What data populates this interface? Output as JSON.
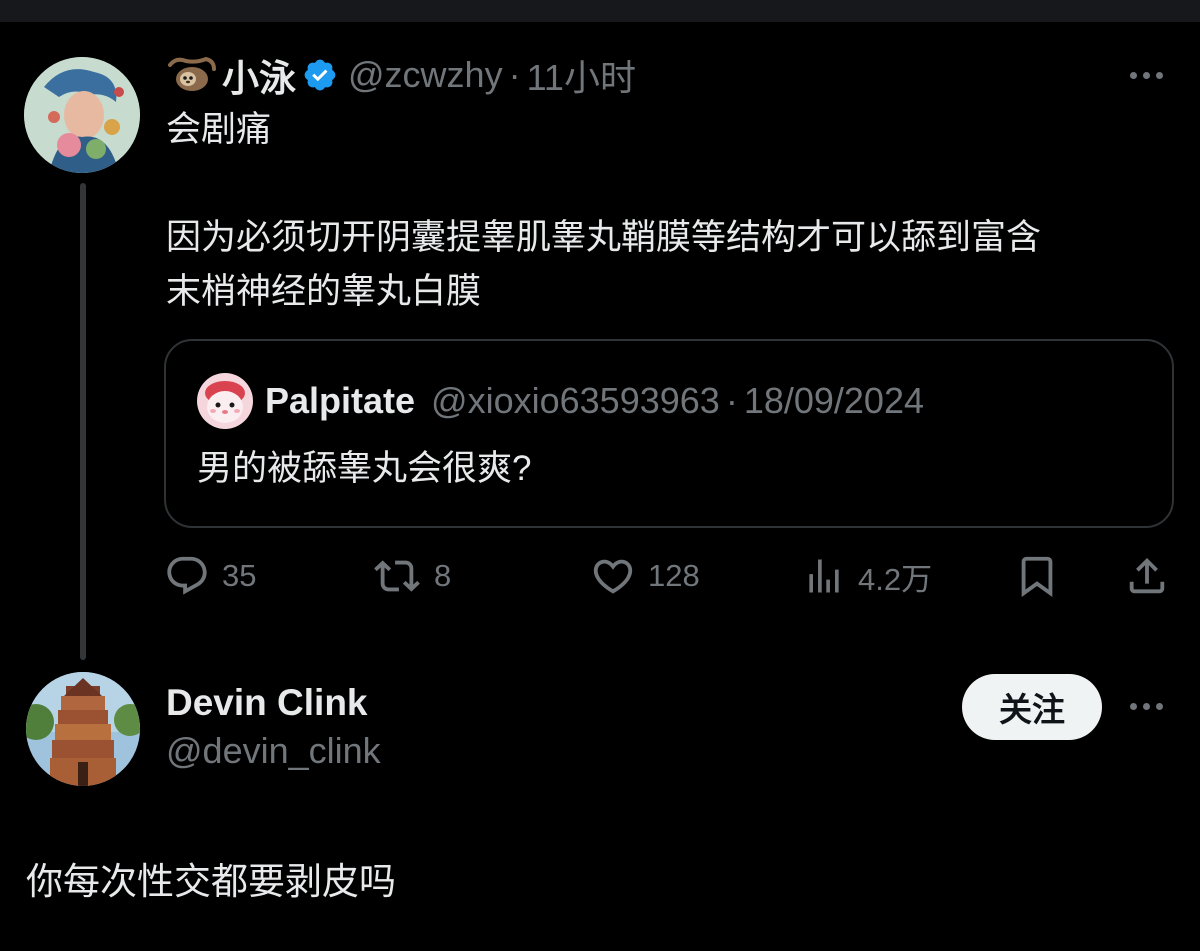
{
  "main_tweet": {
    "emoji": "sloth",
    "display_name": "小泳",
    "verified": true,
    "handle": "@zcwzhy",
    "separator": "·",
    "time": "11小时",
    "text_line_1": "会剧痛",
    "text_line_2": "因为必须切开阴囊提睾肌睾丸鞘膜等结构才可以舔到富含",
    "text_line_3": "末梢神经的睾丸白膜",
    "quoted": {
      "display_name": "Palpitate",
      "handle": "@xioxio63593963",
      "separator": "·",
      "date": "18/09/2024",
      "text": "男的被舔睾丸会很爽?"
    },
    "actions": {
      "replies": "35",
      "retweets": "8",
      "likes": "128",
      "views": "4.2万"
    }
  },
  "reply_tweet": {
    "display_name": "Devin Clink",
    "handle": "@devin_clink",
    "follow_label": "关注",
    "text": "你每次性交都要剥皮吗"
  },
  "colors": {
    "background": "#000000",
    "primary_text": "#e7e9ea",
    "secondary_text": "#71767b",
    "border": "#2f3336",
    "verified_blue": "#1d9bf0",
    "follow_button_bg": "#eff3f4"
  },
  "icons": [
    "sloth-icon",
    "verified-badge-icon",
    "more-icon",
    "reply-icon",
    "retweet-icon",
    "like-icon",
    "views-icon",
    "bookmark-icon",
    "share-icon"
  ]
}
